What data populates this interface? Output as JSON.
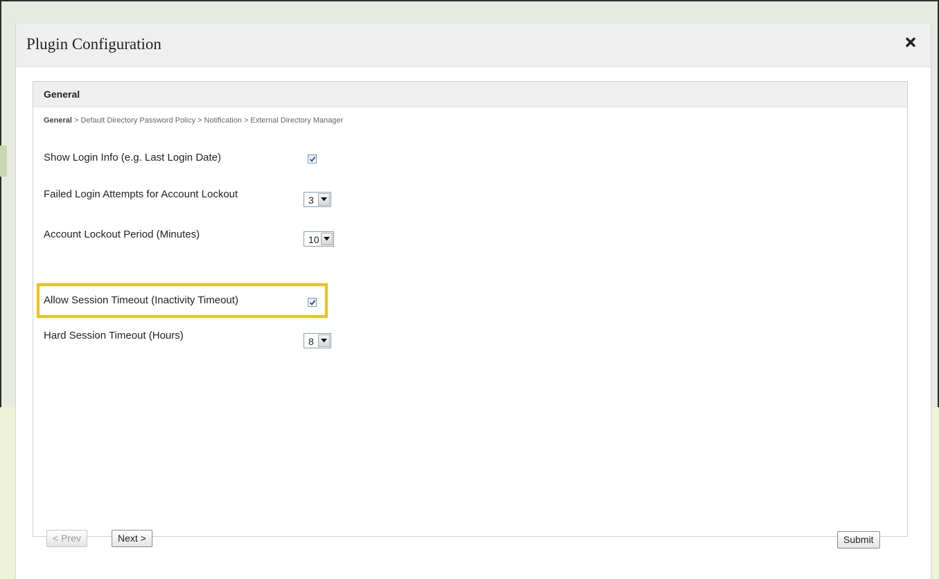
{
  "dialog": {
    "title": "Plugin Configuration"
  },
  "panel": {
    "title": "General",
    "breadcrumb": {
      "current": "General",
      "separator": ">",
      "steps": [
        "Default Directory Password Policy",
        "Notification",
        "External Directory Manager"
      ]
    }
  },
  "form": {
    "show_login_info": {
      "label": "Show Login Info (e.g. Last Login Date)",
      "checked": true
    },
    "failed_login_attempts": {
      "label": "Failed Login Attempts for Account Lockout",
      "value": "3"
    },
    "account_lockout_period": {
      "label": "Account Lockout Period (Minutes)",
      "value": "10"
    },
    "allow_session_timeout": {
      "label": "Allow Session Timeout (Inactivity Timeout)",
      "checked": true
    },
    "hard_session_timeout": {
      "label": "Hard Session Timeout (Hours)",
      "value": "8"
    }
  },
  "buttons": {
    "prev": "< Prev",
    "next": "Next >",
    "submit": "Submit"
  },
  "colors": {
    "highlight": "#f6bf10",
    "backdrop": "#e6eadf",
    "backdrop_band": "#eef3d6"
  }
}
